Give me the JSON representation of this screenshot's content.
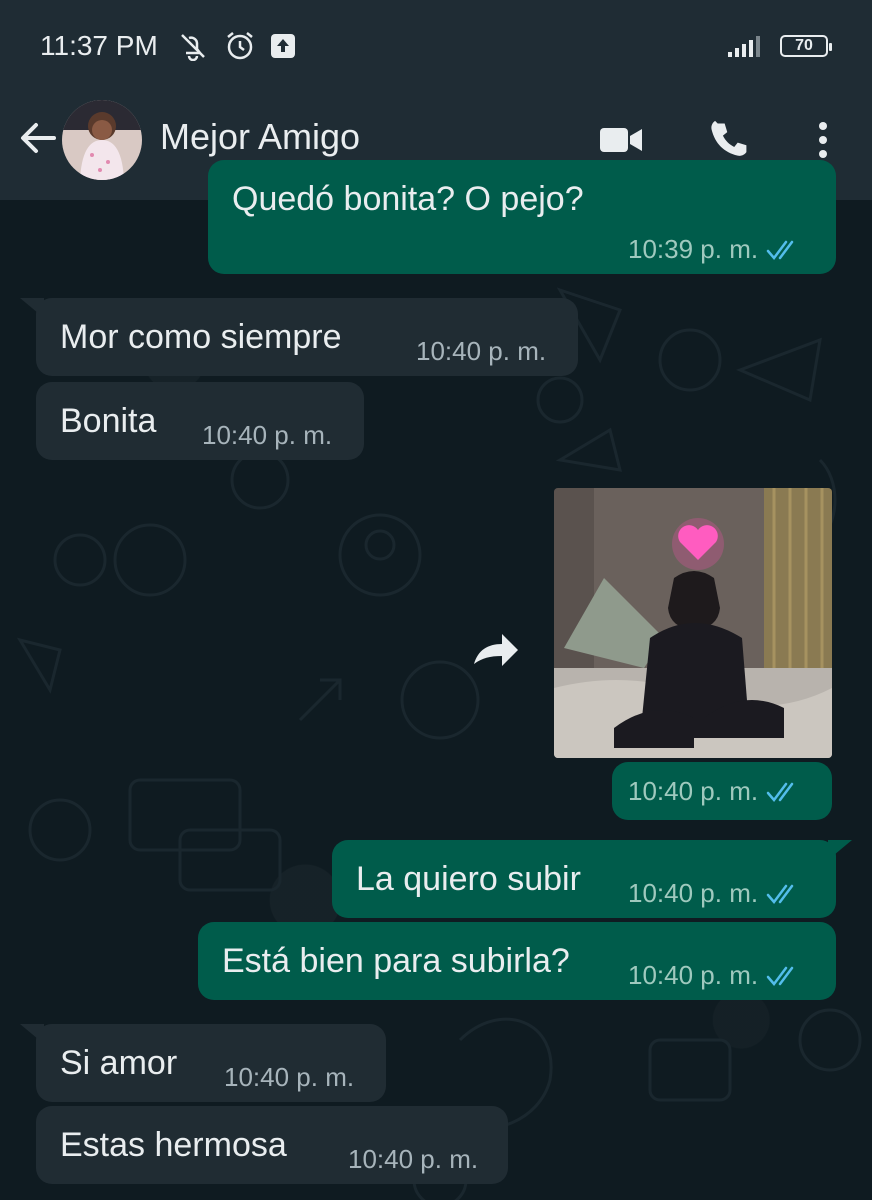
{
  "status_bar": {
    "time": "11:37 PM",
    "battery": "70",
    "icons": [
      "muted-bell-icon",
      "alarm-icon",
      "upload-icon",
      "signal-icon",
      "battery-icon"
    ]
  },
  "header": {
    "contact_name": "Mejor Amigo",
    "icons": [
      "back-arrow-icon",
      "video-call-icon",
      "phone-icon",
      "more-options-icon"
    ]
  },
  "messages": [
    {
      "direction": "out",
      "text": "Quedó bonita? O pejo?",
      "time": "10:39 p. m.",
      "status": "read"
    },
    {
      "direction": "in",
      "text": "Mor como siempre",
      "time": "10:40 p. m."
    },
    {
      "direction": "in",
      "text": "Bonita",
      "time": "10:40 p. m."
    },
    {
      "direction": "out",
      "type": "image",
      "image_desc_icon": "photo-child-heart",
      "time": "10:40 p. m.",
      "status": "read"
    },
    {
      "direction": "out",
      "text": "La quiero subir",
      "time": "10:40 p. m.",
      "status": "read"
    },
    {
      "direction": "out",
      "text": "Está bien para subirla?",
      "time": "10:40 p. m.",
      "status": "read"
    },
    {
      "direction": "in",
      "text": "Si amor",
      "time": "10:40 p. m."
    },
    {
      "direction": "in",
      "text": "Estas hermosa",
      "time": "10:40 p. m."
    }
  ],
  "colors": {
    "header_bg": "#1f2c34",
    "chat_bg": "#0b141a",
    "bubble_in": "#202c33",
    "bubble_out": "#005c4b",
    "read_ticks": "#53bdeb"
  }
}
